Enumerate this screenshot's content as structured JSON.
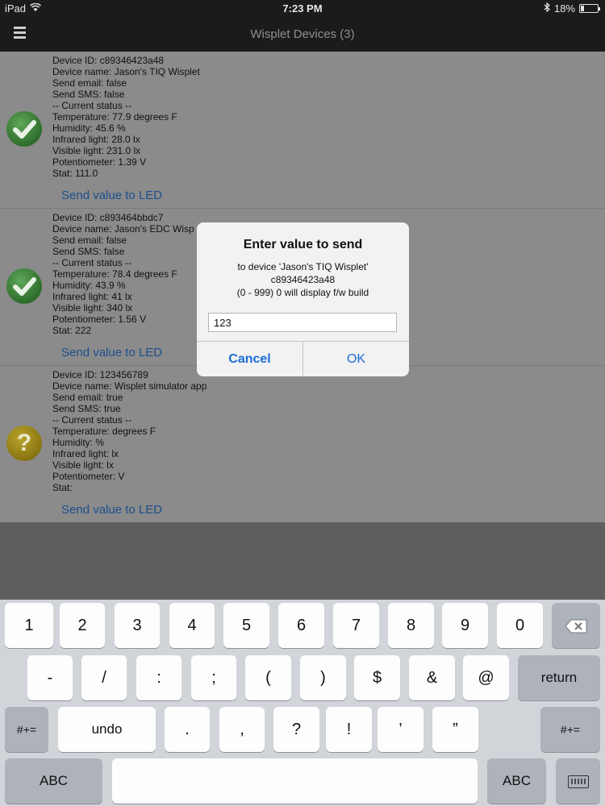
{
  "status_bar": {
    "carrier": "iPad",
    "time": "7:23 PM",
    "battery": "18%",
    "battery_level": 0.18
  },
  "navbar": {
    "title": "Wisplet Devices (3)"
  },
  "devices": [
    {
      "status": "ok",
      "lines": [
        "Device ID: c89346423a48",
        "Device name: Jason's TIQ Wisplet",
        "Send email: false",
        "Send SMS: false",
        "-- Current status --",
        "Temperature: 77.9 degrees F",
        "Humidity: 45.6 %",
        "Infrared light: 28.0 lx",
        "Visible light: 231.0 lx",
        "Potentiometer: 1.39 V",
        "Stat: 111.0"
      ],
      "send_label": "Send value to LED"
    },
    {
      "status": "ok",
      "lines": [
        "Device ID: c893464bbdc7",
        "Device name: Jason's EDC Wisp",
        "Send email: false",
        "Send SMS: false",
        "-- Current status --",
        "Temperature: 78.4 degrees F",
        "Humidity: 43.9 %",
        "Infrared light: 41 lx",
        "Visible light: 340 lx",
        "Potentiometer: 1.56 V",
        "Stat: 222"
      ],
      "send_label": "Send value to LED"
    },
    {
      "status": "unknown",
      "lines": [
        "Device ID: 123456789",
        "Device name: Wisplet simulator app",
        "Send email: true",
        "Send SMS: true",
        "-- Current status --",
        "Temperature:  degrees F",
        "Humidity:  %",
        "Infrared light:  lx",
        "Visible light:  lx",
        "Potentiometer:  V",
        "Stat:"
      ],
      "send_label": "Send value to LED"
    }
  ],
  "alert": {
    "title": "Enter value to send",
    "message": [
      "to device 'Jason's TIQ Wisplet'",
      "c89346423a48",
      "(0 - 999) 0 will display f/w build"
    ],
    "input_value": "123",
    "cancel_label": "Cancel",
    "ok_label": "OK"
  },
  "keyboard": {
    "row1": [
      "1",
      "2",
      "3",
      "4",
      "5",
      "6",
      "7",
      "8",
      "9",
      "0"
    ],
    "row2": [
      "-",
      "/",
      ":",
      ";",
      "(",
      ")",
      "$",
      "&",
      "@"
    ],
    "return_label": "return",
    "row3_left": "#+=",
    "undo_label": "undo",
    "row3": [
      ".",
      ",",
      "?",
      "!",
      "’",
      "”"
    ],
    "row3_right": "#+=",
    "abc_left": "ABC",
    "abc_right": "ABC"
  }
}
